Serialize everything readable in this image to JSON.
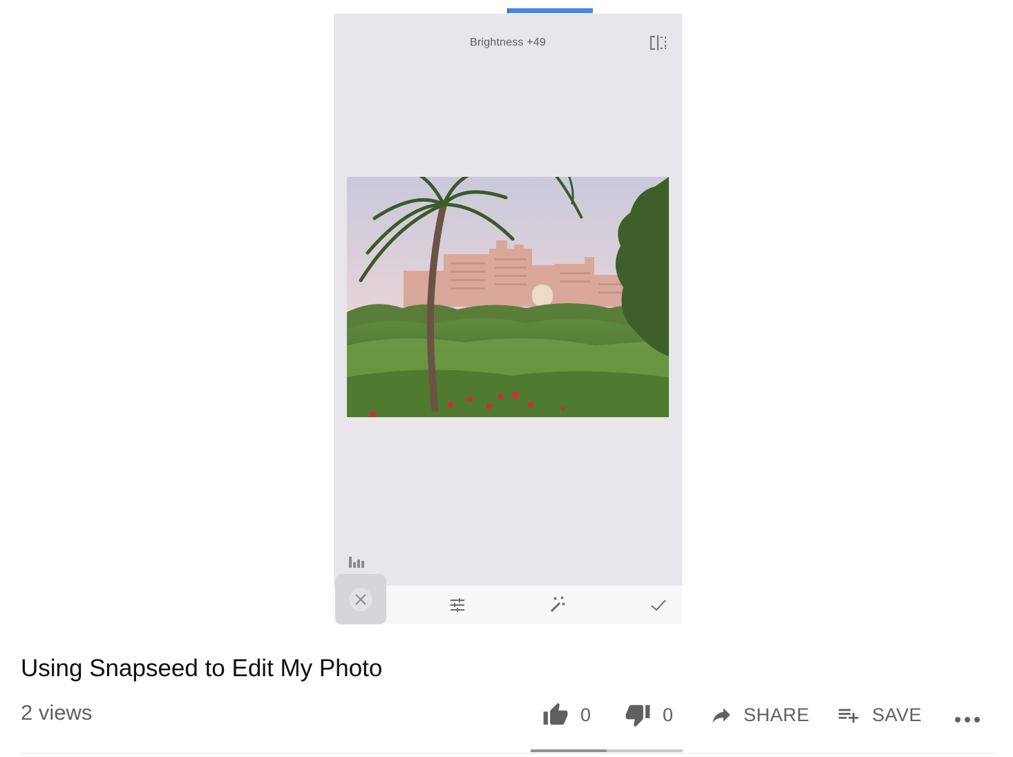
{
  "video": {
    "edit_status": "Brightness +49",
    "photo_alt": "Palm trees and pink resort buildings behind green hedges"
  },
  "toolbar": {
    "cancel_icon": "close-icon",
    "adjust_icon": "sliders-icon",
    "auto_icon": "magic-wand-icon",
    "apply_icon": "check-icon"
  },
  "meta": {
    "title": "Using Snapseed to Edit My Photo",
    "views": "2 views",
    "likes": "0",
    "dislikes": "0",
    "share_label": "SHARE",
    "save_label": "SAVE"
  },
  "rating": {
    "like_fraction": 0.5
  },
  "colors": {
    "accent": "#4a86e8",
    "text_secondary": "#606060",
    "frame_bg": "#e8e6ea"
  }
}
